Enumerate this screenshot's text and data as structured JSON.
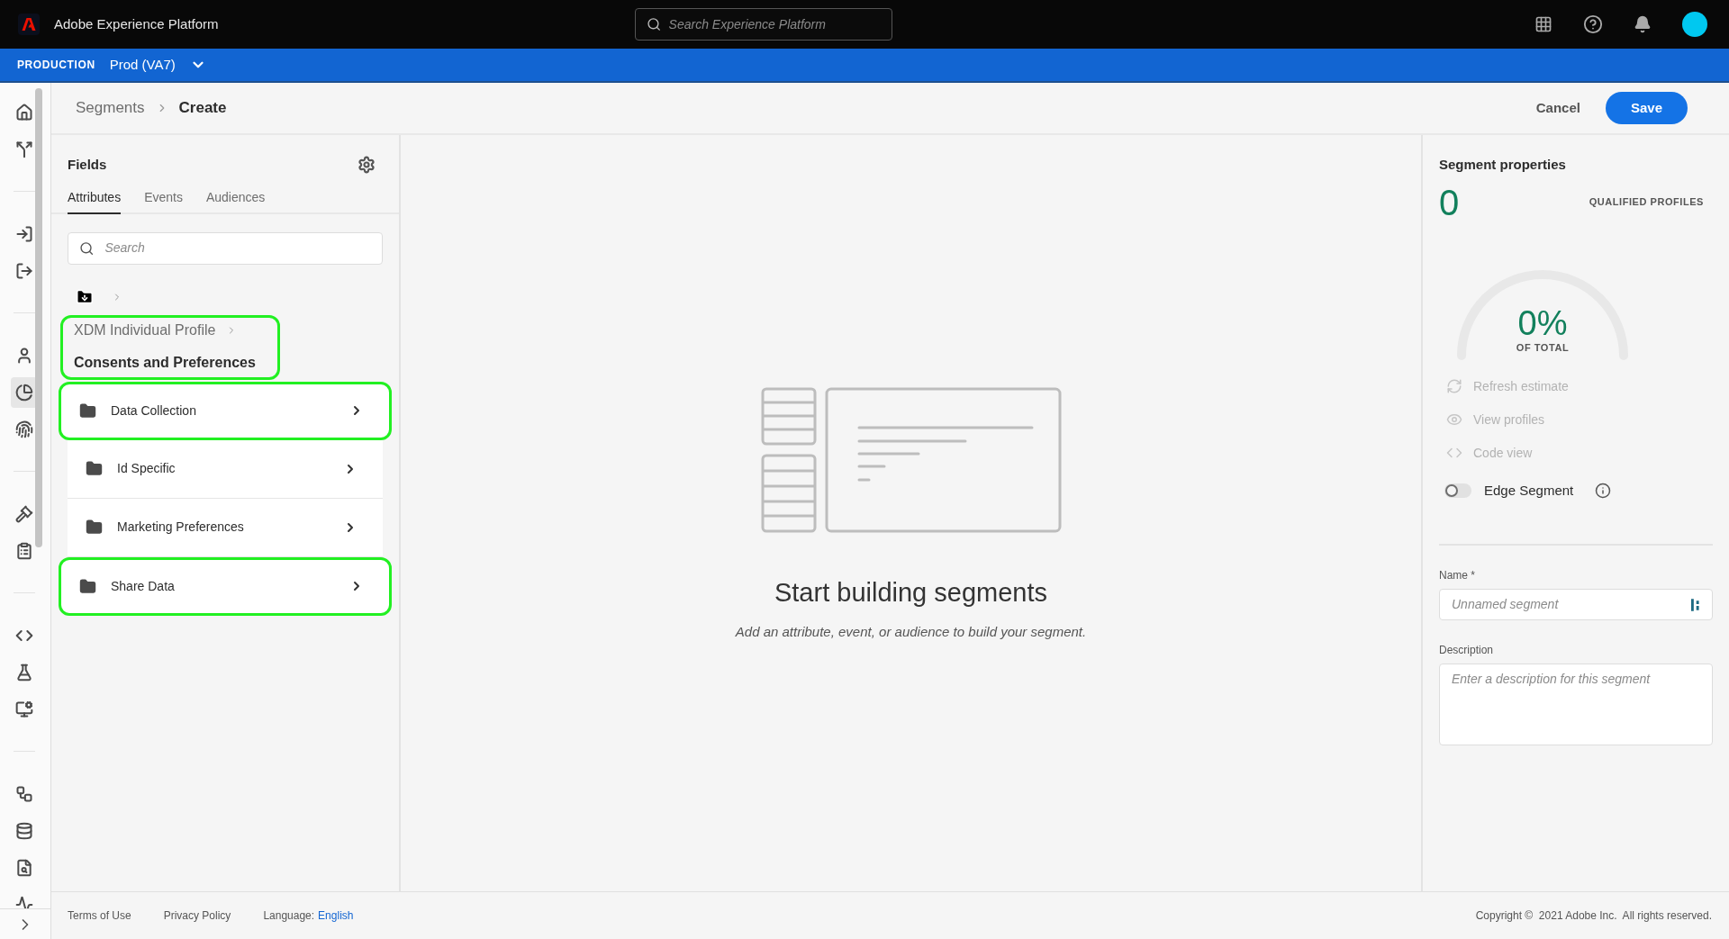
{
  "app_bar": {
    "title": "Adobe Experience Platform",
    "search": {
      "placeholder": "Search Experience Platform"
    }
  },
  "sandbox_bar": {
    "label": "PRODUCTION",
    "sandbox": "Prod (VA7)"
  },
  "nav": [
    {
      "selected": false
    },
    {
      "selected": false
    },
    {
      "selected": false
    },
    {
      "selected": false
    },
    {
      "selected": false
    },
    {
      "selected": true
    },
    {
      "selected": false
    },
    {
      "selected": false
    },
    {
      "selected": false
    },
    {
      "selected": false
    },
    {
      "selected": false
    },
    {
      "selected": false
    },
    {
      "selected": false
    },
    {
      "selected": false
    },
    {
      "selected": false
    },
    {
      "selected": false
    }
  ],
  "breadcrumb": [
    "Segments",
    "Create"
  ],
  "actions": {
    "cancel": "Cancel",
    "save": "Save"
  },
  "fields_panel": {
    "title": "Fields",
    "tabs": [
      {
        "label": "Attributes",
        "selected": true
      },
      {
        "label": "Events",
        "selected": false
      },
      {
        "label": "Audiences",
        "selected": false
      }
    ],
    "search": {
      "placeholder": "Search"
    },
    "path": {
      "parent": "XDM Individual Profile",
      "current": "Consents and Preferences",
      "highlighted": true
    },
    "items": [
      {
        "label": "Data Collection",
        "highlighted": true
      },
      {
        "label": "Id Specific",
        "highlighted": false
      },
      {
        "label": "Marketing Preferences",
        "highlighted": false
      },
      {
        "label": "Share Data",
        "highlighted": true
      }
    ]
  },
  "canvas": {
    "title": "Start building segments",
    "subtitle": "Add an attribute, event, or audience to build your segment."
  },
  "properties": {
    "title": "Segment properties",
    "count": "0",
    "count_label": "QUALIFIED PROFILES",
    "percent": "0%",
    "percent_label": "OF TOTAL",
    "actions": [
      "Refresh estimate",
      "View profiles",
      "Code view"
    ],
    "edge_segment": {
      "label": "Edge Segment",
      "on": false
    },
    "name": {
      "label": "Name *",
      "placeholder": "Unnamed segment"
    },
    "description": {
      "label": "Description",
      "placeholder": "Enter a description for this segment"
    }
  },
  "footer": {
    "links": [
      "Terms of Use",
      "Privacy Policy"
    ],
    "language_label": "Language:",
    "language": "English",
    "copyright": "Copyright ©  2021 Adobe Inc.  All rights reserved."
  }
}
